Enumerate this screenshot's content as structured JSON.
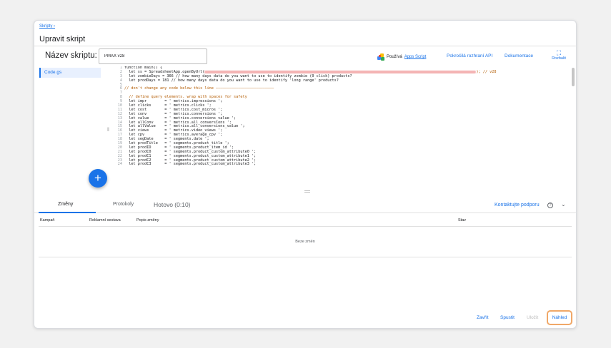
{
  "breadcrumb": "Skripty ›",
  "page_title": "Upravit skript",
  "script_name": {
    "label": "Název skriptu:",
    "value": "PMAX v28"
  },
  "header": {
    "apps_script_prefix": "Používá",
    "apps_script_link": "Apps Script",
    "advanced_api": "Pokročilá rozhraní API",
    "docs": "Dokumentace",
    "expand_label": "Rozbalit"
  },
  "files": [
    "Code.gs"
  ],
  "code_lines": [
    {
      "n": "1",
      "t": "function main() {",
      "c": false
    },
    {
      "n": "2",
      "t": "  let ss = SpreadsheetApp.openByUrl(",
      "c": false,
      "blur": 380,
      "after": "); // v28"
    },
    {
      "n": "3",
      "t": "  let zombieDays = 366 // how many days data do you want to use to identify zombie (0 click) products?",
      "c": false
    },
    {
      "n": "4",
      "t": "  let prodDays = 181 // how many days data do you want to use to identify 'long range' products?",
      "c": false
    },
    {
      "n": "5",
      "t": "",
      "c": false
    },
    {
      "n": "6",
      "t": "// don't change any code below this line ——————————————————————————",
      "c": true
    },
    {
      "n": "7",
      "t": "",
      "c": false
    },
    {
      "n": "8",
      "t": "  // define query elements. wrap with spaces for safety",
      "c": true
    },
    {
      "n": "9",
      "t": "  let impr        = ' metrics.impressions ';",
      "c": false
    },
    {
      "n": "10",
      "t": "  let clicks      = ' metrics.clicks ';",
      "c": false
    },
    {
      "n": "11",
      "t": "  let cost        = ' metrics.cost_micros ';",
      "c": false
    },
    {
      "n": "12",
      "t": "  let conv        = ' metrics.conversions ';",
      "c": false
    },
    {
      "n": "13",
      "t": "  let value       = ' metrics.conversions_value ';",
      "c": false
    },
    {
      "n": "14",
      "t": "  let allConv     = ' metrics.all_conversions ';",
      "c": false
    },
    {
      "n": "15",
      "t": "  let allValue    = ' metrics.all_conversions_value ';",
      "c": false
    },
    {
      "n": "16",
      "t": "  let views       = ' metrics.video_views ';",
      "c": false
    },
    {
      "n": "17",
      "t": "  let cpv         = ' metrics.average_cpv ';",
      "c": false
    },
    {
      "n": "18",
      "t": "  let segDate     = ' segments.date ';",
      "c": false
    },
    {
      "n": "19",
      "t": "  let prodTitle   = ' segments.product_title ';",
      "c": false
    },
    {
      "n": "20",
      "t": "  let prodID      = ' segments.product_item_id ';",
      "c": false
    },
    {
      "n": "21",
      "t": "  let prodC0      = ' segments.product_custom_attribute0 ';",
      "c": false
    },
    {
      "n": "22",
      "t": "  let prodC1      = ' segments.product_custom_attribute1 ';",
      "c": false
    },
    {
      "n": "23",
      "t": "  let prodC2      = ' segments.product_custom_attribute2 ';",
      "c": false
    },
    {
      "n": "24",
      "t": "  let prodC3      = ' segments.product_custom_attribute3 ';",
      "c": false
    }
  ],
  "tabs": {
    "changes": "Změny",
    "logs": "Protokoly",
    "done": "Hotovo (0:10)"
  },
  "support": "Kontaktujte podporu",
  "table": {
    "headers": [
      "Kampaň",
      "Reklamní sestava",
      "Popis změny",
      "Stav"
    ],
    "empty": "Beze změn"
  },
  "footer": {
    "close": "Zavřít",
    "run": "Spustit",
    "save": "Uložit",
    "preview": "Náhled"
  },
  "colors": {
    "accent": "#1a73e8",
    "highlight": "#f0a868"
  }
}
